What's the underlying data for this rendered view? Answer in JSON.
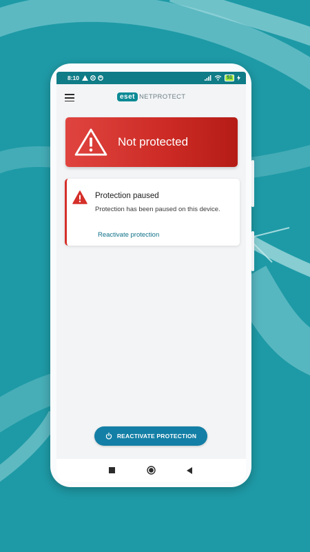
{
  "status_bar": {
    "time": "8:10",
    "battery": "51"
  },
  "app": {
    "logo_badge": "eset",
    "logo_text": "NETPROTECT"
  },
  "banner": {
    "title": "Not protected"
  },
  "card": {
    "title": "Protection paused",
    "description": "Protection has been paused on this device.",
    "link": "Reactivate protection"
  },
  "cta": {
    "label": "REACTIVATE PROTECTION"
  },
  "icons": {
    "menu": "hamburger-icon",
    "banner_warning": "warning-icon",
    "card_warning": "warning-icon",
    "power": "power-icon",
    "nav_recents": "square-icon",
    "nav_home": "circle-icon",
    "nav_back": "triangle-back-icon"
  },
  "colors": {
    "background": "#1e9aa6",
    "status_bar": "#0f7c87",
    "brand_teal": "#0c8a95",
    "alert_red": "#cc2a24",
    "button_blue": "#137fa6"
  }
}
